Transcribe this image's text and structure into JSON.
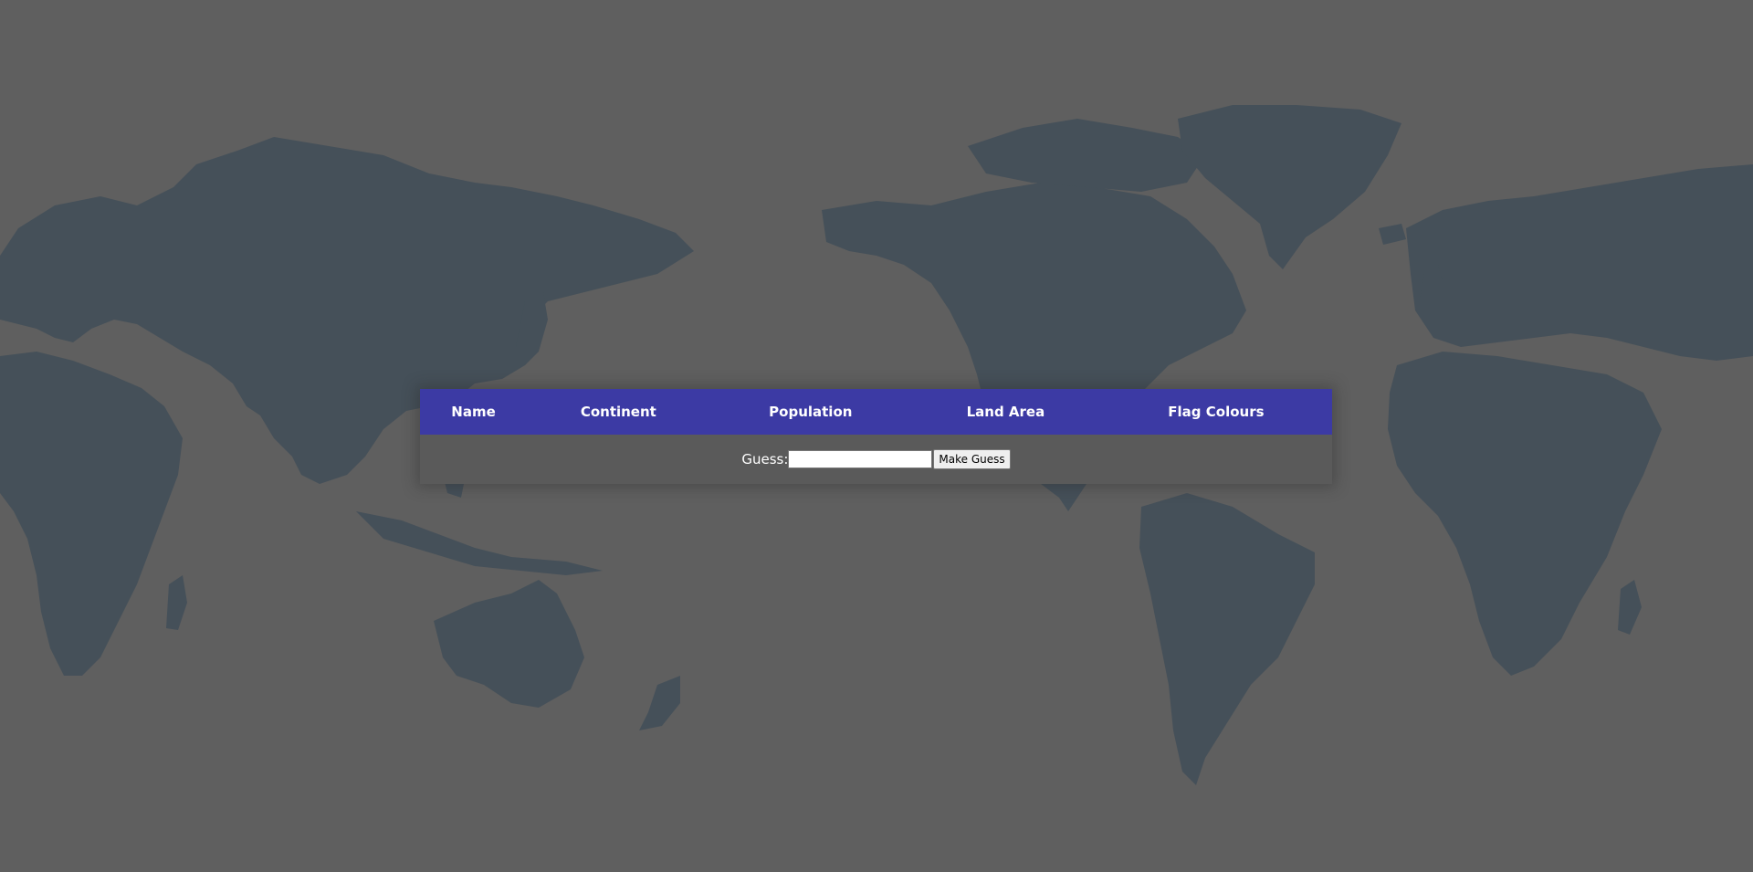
{
  "table": {
    "columns": [
      "Name",
      "Continent",
      "Population",
      "Land Area",
      "Flag Colours"
    ]
  },
  "guess": {
    "label": "Guess:",
    "value": "",
    "button_label": "Make Guess"
  },
  "colors": {
    "background": "#5f5f5f",
    "map_land": "#455059",
    "table_header": "#3c3aa4",
    "panel": "#5a5a5a"
  },
  "background_image": "world-map"
}
